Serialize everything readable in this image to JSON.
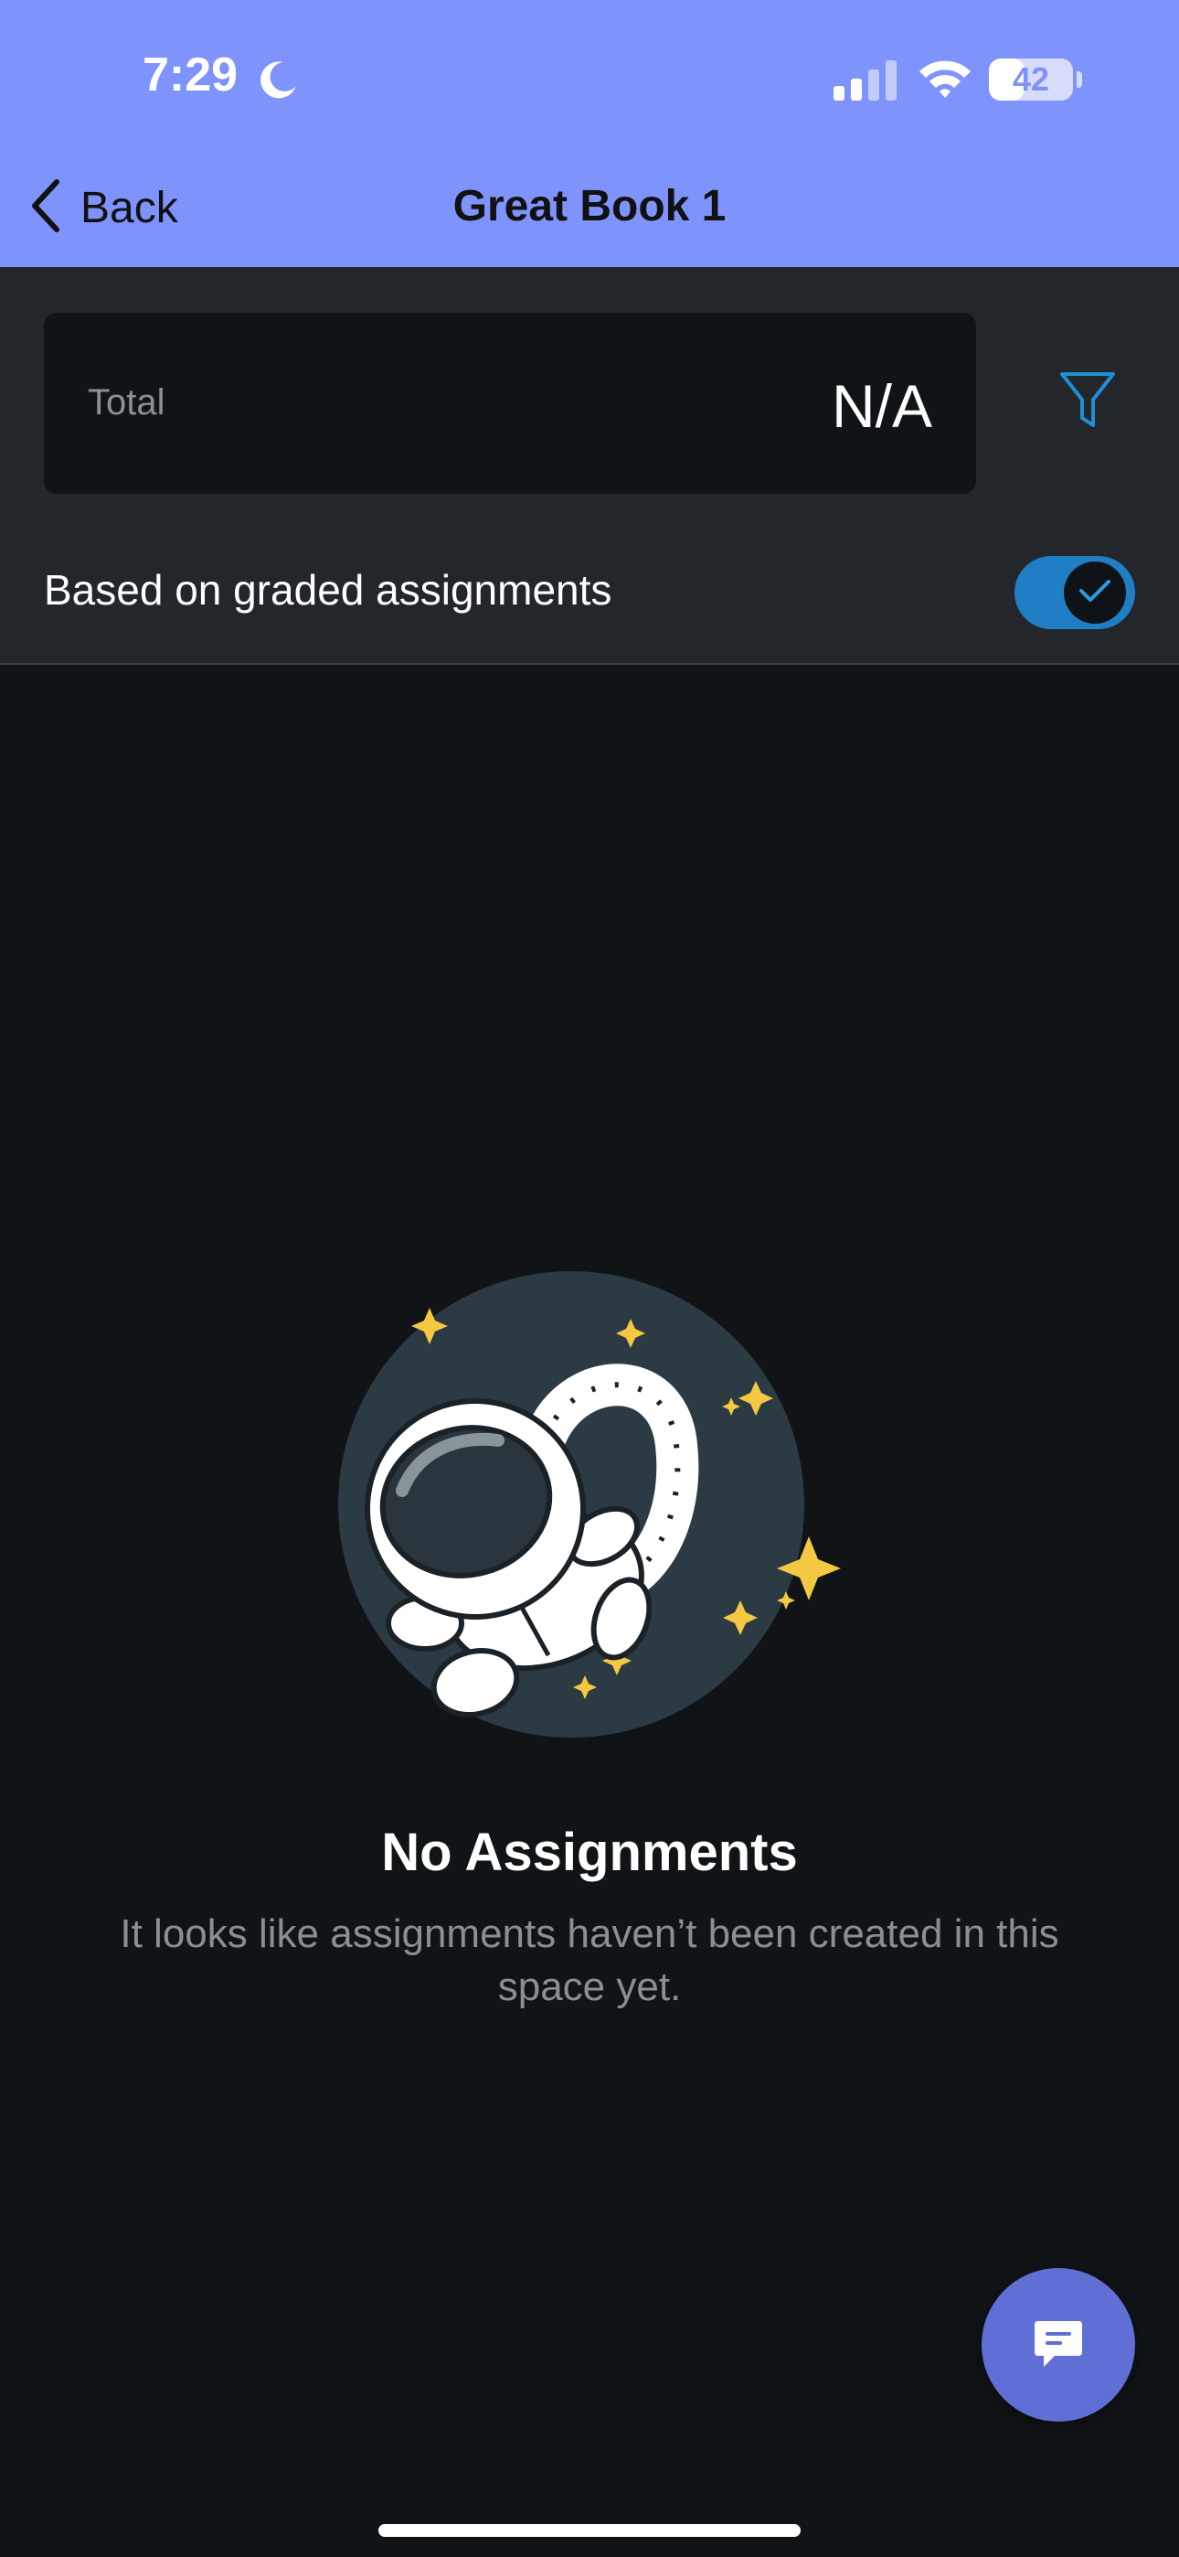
{
  "status_bar": {
    "time": "7:29",
    "battery_text": "42",
    "battery_level": 0.42,
    "icons": [
      "moon-icon",
      "cellular-signal-icon",
      "wifi-icon",
      "battery-icon"
    ]
  },
  "nav": {
    "back_label": "Back",
    "title": "Great Book 1",
    "background_color": "#7f93fc"
  },
  "summary": {
    "total_label": "Total",
    "total_value": "N/A"
  },
  "filter": {
    "icon": "filter-icon",
    "color": "#1f8fd6"
  },
  "graded_toggle": {
    "label": "Based on graded assignments",
    "checked": true,
    "accent_color": "#1f7ec4"
  },
  "empty_state": {
    "illustration": "astronaut-illustration",
    "title": "No Assignments",
    "description": "It looks like assignments haven’t been created in this space yet."
  },
  "chat_button": {
    "icon": "chat-icon",
    "color": "#5f6fd6"
  }
}
